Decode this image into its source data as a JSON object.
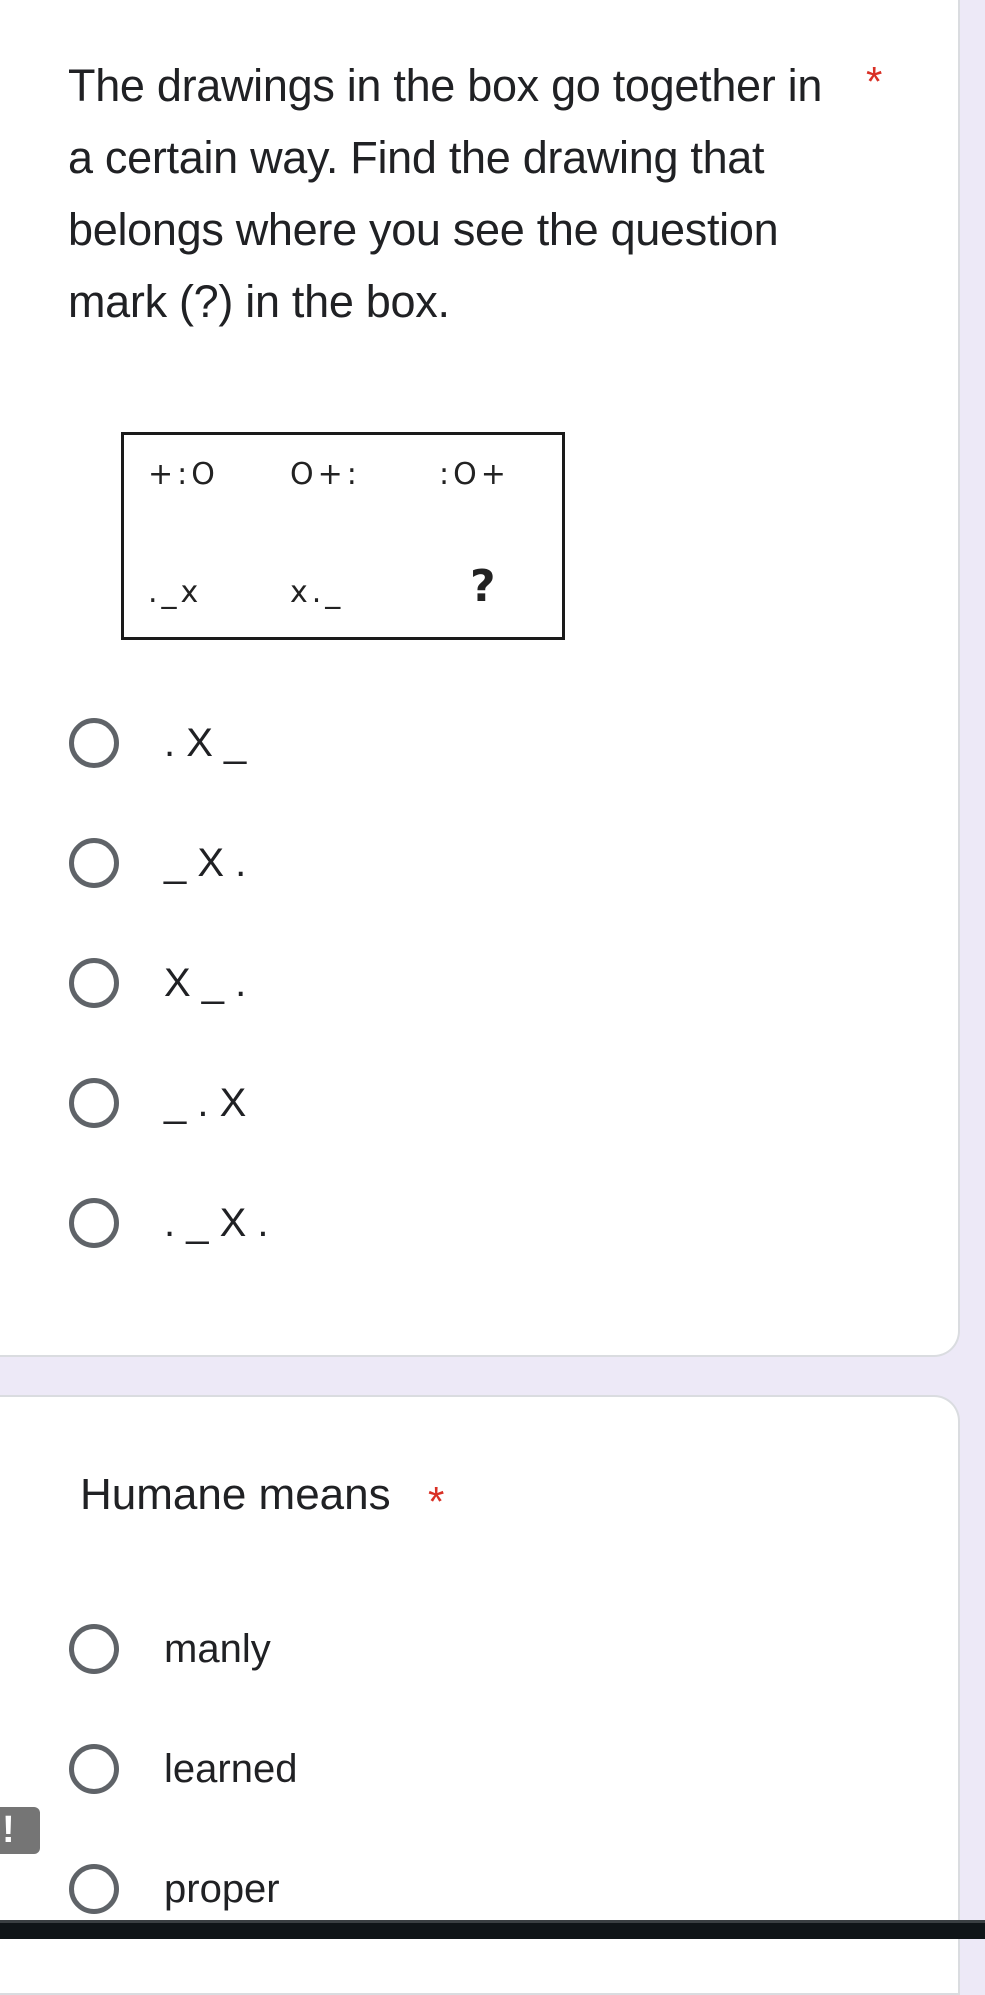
{
  "questions": [
    {
      "text": "The drawings in the box go together in a certain way. Find the drawing that belongs where you see the question mark (?) in the box.",
      "required_marker": "*",
      "figure": {
        "row1": [
          "+:O",
          "O+:",
          ":O+"
        ],
        "row2": [
          "._x",
          "x._",
          "?"
        ]
      },
      "options": [
        ". X _",
        "_ X .",
        "X _ .",
        "_ . X",
        ". _ X ."
      ]
    },
    {
      "text": "Humane means",
      "required_marker": "*",
      "options": [
        "manly",
        "learned",
        "proper"
      ]
    }
  ],
  "feedback_tab": {
    "icon": "exclamation-icon",
    "label": "!"
  },
  "colors": {
    "background": "#ede9f7",
    "card": "#ffffff",
    "required": "#d93025",
    "radio_border": "#5f6368",
    "text": "#202124"
  }
}
